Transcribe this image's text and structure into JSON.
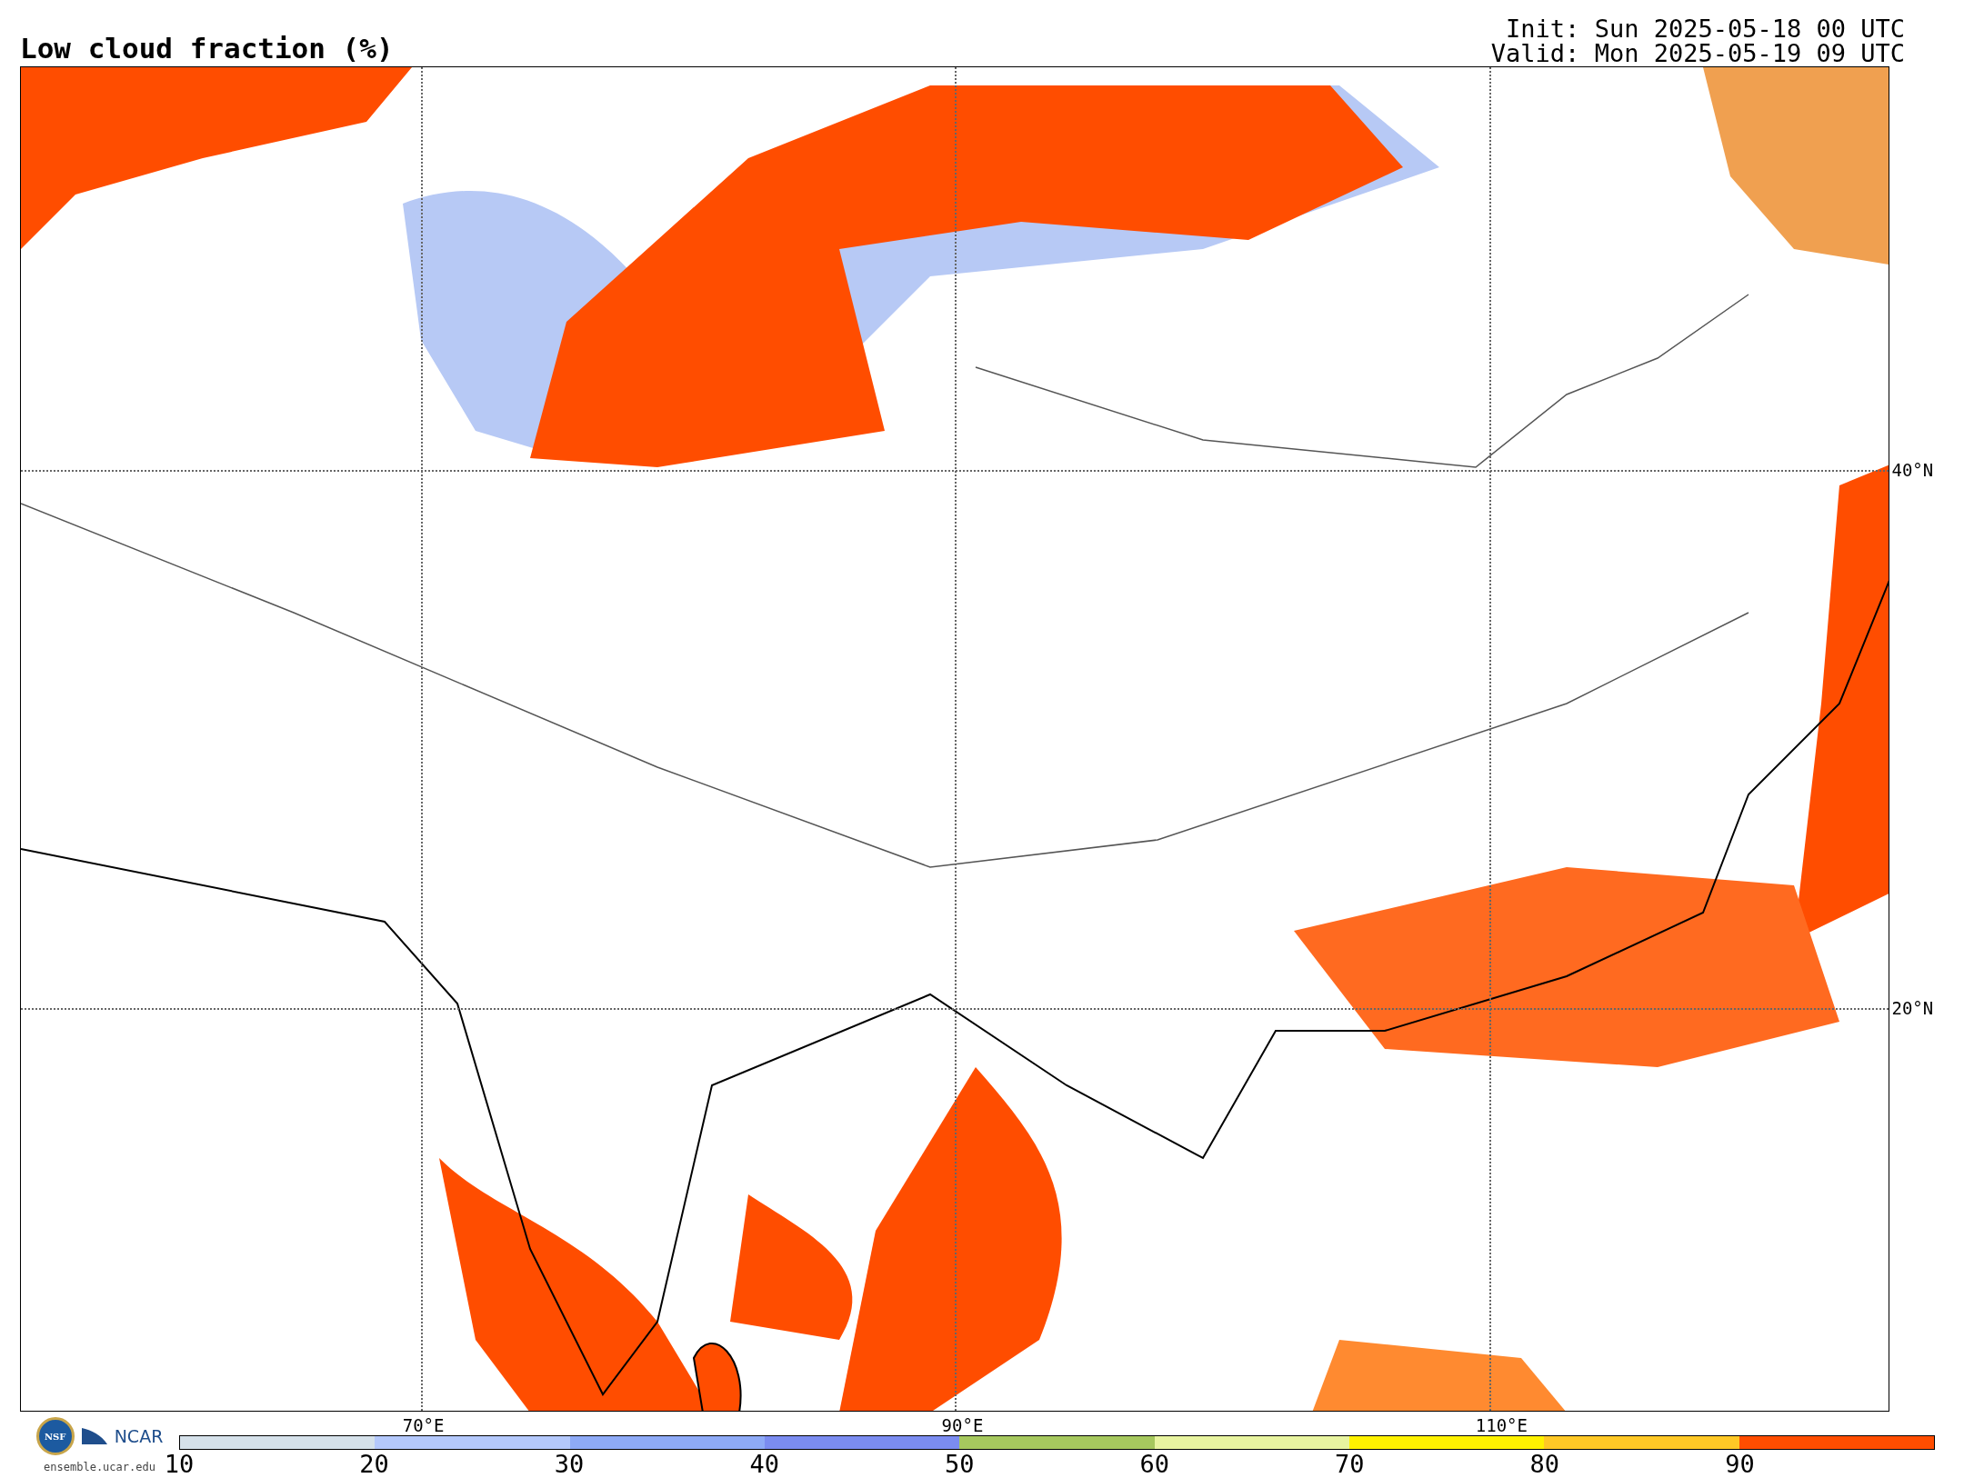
{
  "title": "Low cloud fraction (%)",
  "init": "Init: Sun 2025-05-18 00 UTC",
  "valid": "Valid: Mon 2025-05-19 09 UTC",
  "map": {
    "lat_labels": [
      "40°N",
      "20°N"
    ],
    "lon_labels": [
      "70°E",
      "90°E",
      "110°E"
    ]
  },
  "logos": {
    "nsf": "NSF",
    "ncar": "NCAR",
    "url": "ensemble.ucar.edu"
  },
  "colorbar": {
    "segments": [
      {
        "color": "#d5e1ea"
      },
      {
        "color": "#b4c8fb"
      },
      {
        "color": "#8eaaf6"
      },
      {
        "color": "#7b8cf0"
      },
      {
        "color": "#a6c85e"
      },
      {
        "color": "#e8f4a0"
      },
      {
        "color": "#fff200"
      },
      {
        "color": "#ffc826"
      },
      {
        "color": "#ff4d00"
      }
    ],
    "labels": [
      "10",
      "20",
      "30",
      "40",
      "50",
      "60",
      "70",
      "80",
      "90"
    ]
  }
}
